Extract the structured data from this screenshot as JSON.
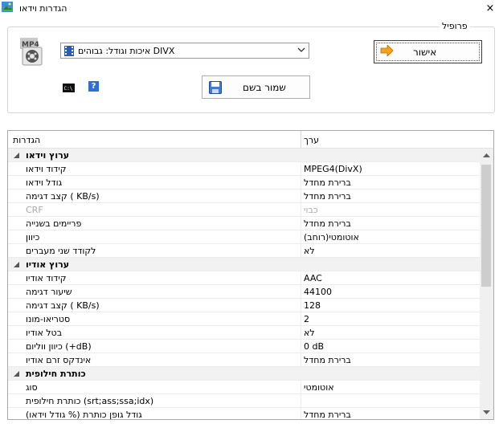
{
  "window": {
    "title": "הגדרות וידאו",
    "close_glyph": "×"
  },
  "profile": {
    "legend": "פרופיל",
    "selected": "איכות וגודל: גבוהים DIVX",
    "ok_label": "אישור",
    "save_label": "שמור בשם",
    "help_glyph": "?"
  },
  "grid": {
    "col_settings": "הגדרות",
    "col_value": "ערך",
    "rows": [
      {
        "name": "ערוץ וידאו",
        "value": "",
        "category": true
      },
      {
        "name": "קידוד וידאו",
        "value": "MPEG4(DivX)"
      },
      {
        "name": "גודל וידאו",
        "value": "ברירת מחדל"
      },
      {
        "name": "קצב דגימה ( KB/s)",
        "value": "ברירת מחדל"
      },
      {
        "name": "CRF",
        "value": "כבוי",
        "disabled": true
      },
      {
        "name": "פריימים בשנייה",
        "value": "ברירת מחדל"
      },
      {
        "name": "כיוון",
        "value": "אוטומטי(רוחב)"
      },
      {
        "name": "לקודד שני מעברים",
        "value": "לא"
      },
      {
        "name": "ערוץ אודיו",
        "value": "",
        "category": true
      },
      {
        "name": "קידוד אודיו",
        "value": "AAC"
      },
      {
        "name": "שיעור דגימה",
        "value": "44100"
      },
      {
        "name": "קצב דגימה ( KB/s)",
        "value": "128"
      },
      {
        "name": "סטריאו-מונו",
        "value": "2"
      },
      {
        "name": "בטל אודיו",
        "value": "לא"
      },
      {
        "name": "כיוון ווליום (+dB)",
        "value": "0 dB"
      },
      {
        "name": "אינדקס זרם אודיו",
        "value": "ברירת מחדל"
      },
      {
        "name": "כותרת חילופית",
        "value": "",
        "category": true
      },
      {
        "name": "סוג",
        "value": "אוטומטי"
      },
      {
        "name": "כותרת חילופית (srt;ass;ssa;idx)",
        "value": ""
      },
      {
        "name": "גודל גופן כותרת (% גודל וידאו)",
        "value": "ברירת מחדל"
      }
    ]
  }
}
